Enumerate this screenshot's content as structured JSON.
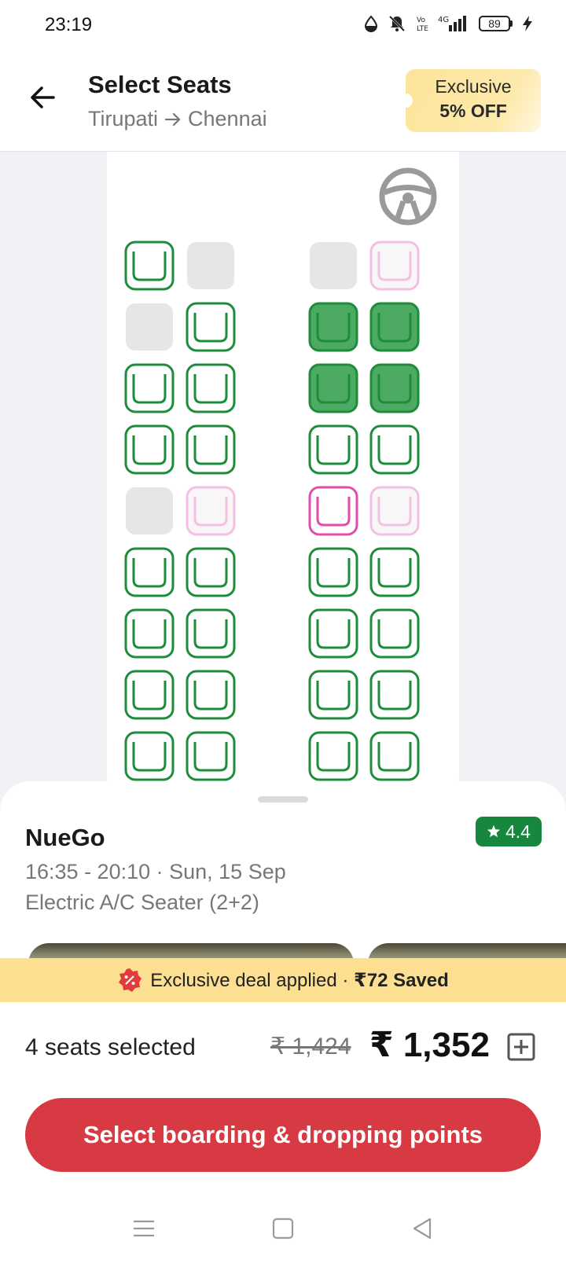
{
  "status_bar": {
    "time": "23:19",
    "battery": "89",
    "network": "4G"
  },
  "header": {
    "title": "Select Seats",
    "origin": "Tirupati",
    "destination": "Chennai",
    "offer_line1": "Exclusive",
    "offer_line2": "5% OFF"
  },
  "seat_layout": {
    "columns_per_row": 4,
    "rows": [
      [
        "available",
        "booked",
        "booked",
        "ladies_booked"
      ],
      [
        "booked",
        "available",
        "selected",
        "selected"
      ],
      [
        "available",
        "available",
        "selected",
        "selected"
      ],
      [
        "available",
        "available",
        "available",
        "available"
      ],
      [
        "booked",
        "ladies_booked",
        "ladies_available",
        "ladies_booked"
      ],
      [
        "available",
        "available",
        "available",
        "available"
      ],
      [
        "available",
        "available",
        "available",
        "available"
      ],
      [
        "available",
        "available",
        "available",
        "available"
      ],
      [
        "available",
        "available",
        "available",
        "available"
      ]
    ]
  },
  "colors": {
    "available": "#1e8c3a",
    "selected_fill": "#4caa63",
    "booked": "#e6e6e8",
    "ladies": "#e24bb0",
    "ladies_booked_fill": "#efe6ea",
    "cta": "#d73a43",
    "rating_badge": "#18873e",
    "deal_strip": "#fddf92"
  },
  "bus_info": {
    "operator": "NueGo",
    "rating": "4.4",
    "timing": "16:35 - 20:10 · Sun, 15 Sep",
    "type": "Electric A/C Seater (2+2)"
  },
  "deal": {
    "text": "Exclusive deal applied · ",
    "saved": "₹72 Saved"
  },
  "summary": {
    "seats_selected": "4 seats selected",
    "original_price": "₹ 1,424",
    "final_price": "₹ 1,352"
  },
  "cta": {
    "label": "Select boarding & dropping points"
  },
  "icons": {
    "back": "arrow-left-icon",
    "steering": "steering-wheel-icon",
    "star": "star-icon",
    "discount": "discount-badge-icon",
    "expand": "plus-square-icon"
  }
}
